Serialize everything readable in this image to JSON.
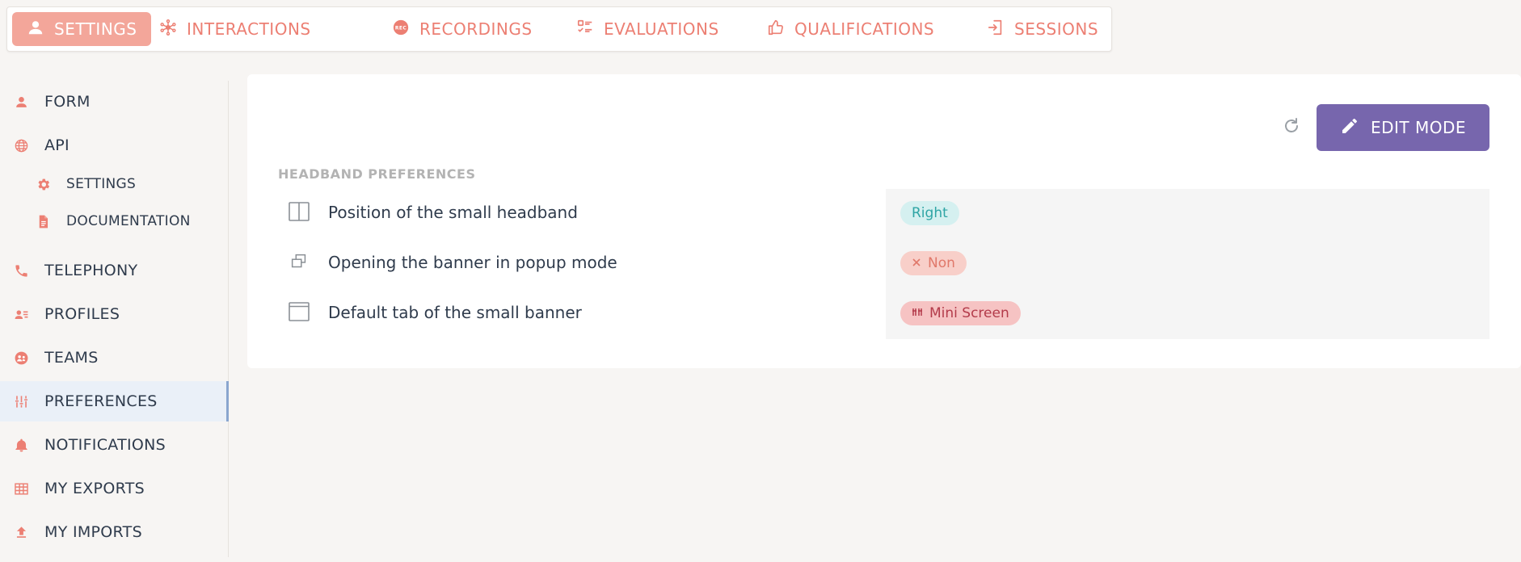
{
  "topnav": {
    "tabs": [
      {
        "label": "SETTINGS",
        "icon": "person-icon",
        "active": true
      },
      {
        "label": "INTERACTIONS",
        "icon": "network-icon"
      },
      {
        "label": "RECORDINGS",
        "icon": "rec-icon",
        "icon_text": "REC"
      },
      {
        "label": "EVALUATIONS",
        "icon": "checklist-icon"
      },
      {
        "label": "QUALIFICATIONS",
        "icon": "thumbs-up-icon"
      },
      {
        "label": "SESSIONS",
        "icon": "login-icon"
      }
    ]
  },
  "sidebar": {
    "items": [
      {
        "label": "FORM",
        "icon": "person-icon"
      },
      {
        "label": "API",
        "icon": "globe-icon"
      },
      {
        "label": "SETTINGS",
        "icon": "gear-icon"
      },
      {
        "label": "DOCUMENTATION",
        "icon": "document-icon"
      },
      {
        "label": "TELEPHONY",
        "icon": "phone-icon"
      },
      {
        "label": "PROFILES",
        "icon": "profile-card-icon"
      },
      {
        "label": "TEAMS",
        "icon": "team-icon"
      },
      {
        "label": "PREFERENCES",
        "icon": "sliders-icon",
        "active": true
      },
      {
        "label": "NOTIFICATIONS",
        "icon": "bell-icon"
      },
      {
        "label": "MY EXPORTS",
        "icon": "table-icon"
      },
      {
        "label": "MY IMPORTS",
        "icon": "upload-icon"
      }
    ]
  },
  "main": {
    "edit_button_label": "EDIT MODE",
    "section_title": "HEADBAND PREFERENCES",
    "rows": [
      {
        "label": "Position of the small headband",
        "icon": "split-panel-icon",
        "value": "Right"
      },
      {
        "label": "Opening the banner in popup mode",
        "icon": "popup-windows-icon",
        "value": "Non",
        "value_icon": "x-icon"
      },
      {
        "label": "Default tab of the small banner",
        "icon": "window-icon",
        "value": "Mini Screen",
        "value_icon": "columns-icon"
      }
    ]
  },
  "colors": {
    "accent": "#ec7f73",
    "active_tab_bg": "#f3a69a",
    "primary_button": "#7766ad",
    "badge_right_bg": "#d5f0f0",
    "badge_right_text": "#2fa5a5",
    "badge_non_bg": "#f8cfc9",
    "badge_mini_bg": "#f6c3c3",
    "badge_mini_text": "#b33b4a"
  }
}
